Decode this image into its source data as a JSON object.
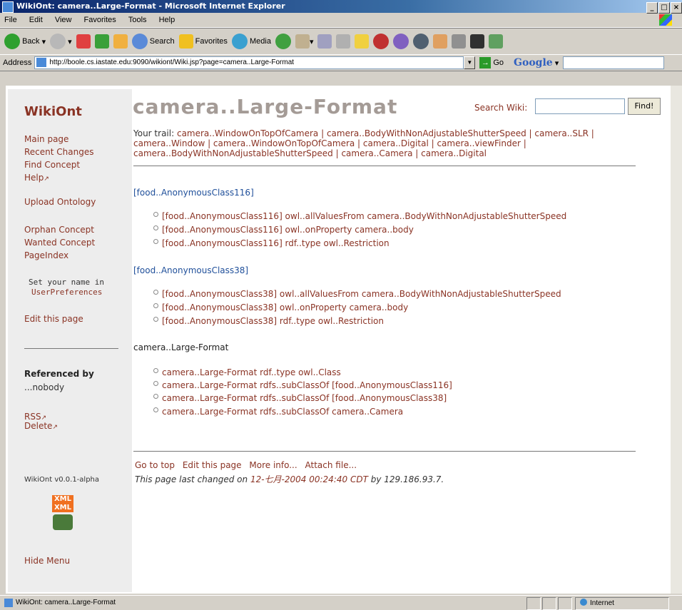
{
  "window": {
    "title": "WikiOnt: camera..Large-Format - Microsoft Internet Explorer"
  },
  "menu": [
    "File",
    "Edit",
    "View",
    "Favorites",
    "Tools",
    "Help"
  ],
  "toolbar": {
    "back": "Back",
    "search": "Search",
    "favorites": "Favorites",
    "media": "Media"
  },
  "address": {
    "label": "Address",
    "url": "http://boole.cs.iastate.edu:9090/wikiont/Wiki.jsp?page=camera..Large-Format",
    "go": "Go",
    "google": "Google"
  },
  "sidebar": {
    "title": "WikiOnt",
    "main_page": "Main page",
    "recent_changes": "Recent Changes",
    "find_concept": "Find Concept",
    "help": "Help",
    "upload": "Upload Ontology",
    "orphan": "Orphan Concept",
    "wanted": "Wanted Concept",
    "pageindex": "PageIndex",
    "set_name": "Set your name in",
    "user_prefs": "UserPreferences",
    "edit": "Edit this page",
    "referenced_by": "Referenced by",
    "nobody": "...nobody",
    "rss": "RSS",
    "delete": "Delete",
    "version": "WikiOnt v0.0.1-alpha",
    "xml1": "XML",
    "xml2": "XML",
    "hide_menu": "Hide Menu"
  },
  "main": {
    "title": "camera..Large-Format",
    "search_label": "Search Wiki:",
    "find_button": "Find!",
    "trail_label": "Your trail:",
    "trail_line1": "camera..WindowOnTopOfCamera | camera..BodyWithNonAdjustableShutterSpeed | camera..SLR |",
    "trail_line2": "camera..Window | camera..WindowOnTopOfCamera | camera..Digital | camera..viewFinder |",
    "trail_line3": "camera..BodyWithNonAdjustableShutterSpeed | camera..Camera | camera..Digital",
    "sections": [
      {
        "heading": "[food..AnonymousClass116]",
        "items": [
          "[food..AnonymousClass116] owl..allValuesFrom camera..BodyWithNonAdjustableShutterSpeed",
          "[food..AnonymousClass116] owl..onProperty camera..body",
          "[food..AnonymousClass116] rdf..type owl..Restriction"
        ]
      },
      {
        "heading": "[food..AnonymousClass38]",
        "items": [
          "[food..AnonymousClass38] owl..allValuesFrom camera..BodyWithNonAdjustableShutterSpeed",
          "[food..AnonymousClass38] owl..onProperty camera..body",
          "[food..AnonymousClass38] rdf..type owl..Restriction"
        ]
      },
      {
        "heading": "camera..Large-Format",
        "items": [
          "camera..Large-Format rdf..type owl..Class",
          "camera..Large-Format rdfs..subClassOf [food..AnonymousClass116]",
          "camera..Large-Format rdfs..subClassOf [food..AnonymousClass38]",
          "camera..Large-Format rdfs..subClassOf camera..Camera"
        ]
      }
    ],
    "footer": {
      "top": "Go to top",
      "edit": "Edit this page",
      "more": "More info...",
      "attach": "Attach file...",
      "changed_prefix": "This page last changed on",
      "changed_date": "12-七月-2004 00:24:40 CDT",
      "changed_by": "by 129.186.93.7."
    }
  },
  "status": {
    "text": "WikiOnt: camera..Large-Format",
    "zone": "Internet"
  }
}
